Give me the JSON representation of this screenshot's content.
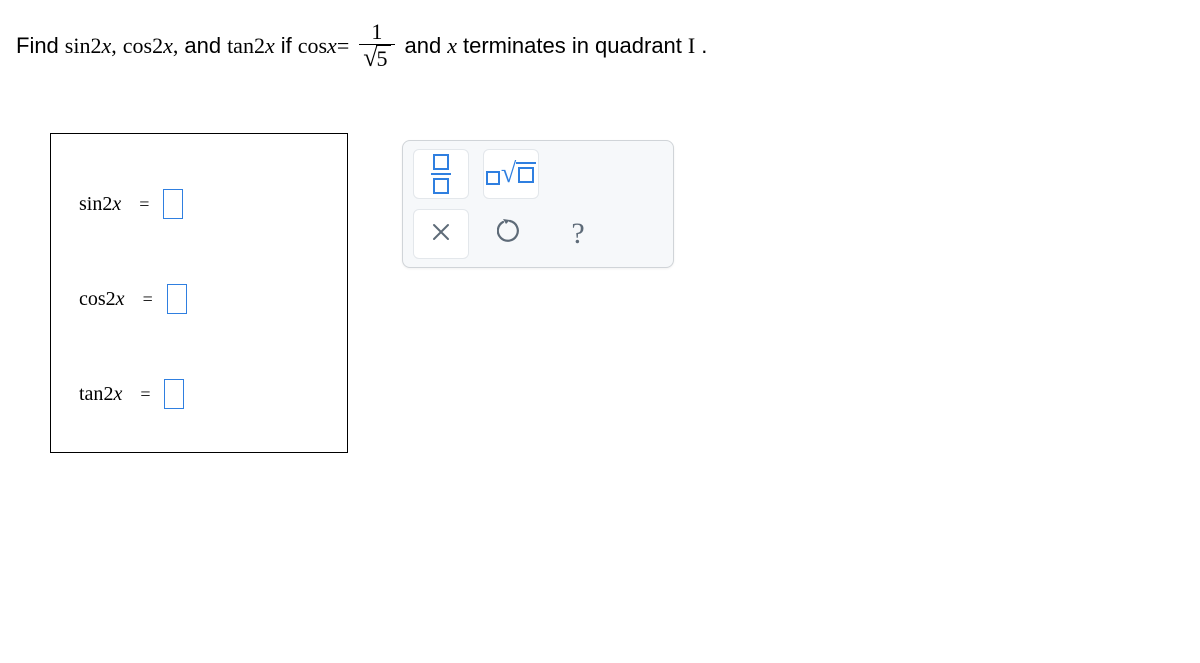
{
  "problem": {
    "prefix": "Find",
    "t1": "sin",
    "t2": "2",
    "var": "x",
    "comma": ",",
    "t3": "cos",
    "and1": "and",
    "t4": "tan",
    "if": "if",
    "cosx": "cos",
    "eq": "=",
    "num": "1",
    "den_rad": "5",
    "and2": "and",
    "term": "terminates in quadrant",
    "quad": "I",
    "period": "."
  },
  "answers": {
    "r1": {
      "fn": "sin",
      "arg": "2",
      "var": "x"
    },
    "r2": {
      "fn": "cos",
      "arg": "2",
      "var": "x"
    },
    "r3": {
      "fn": "tan",
      "arg": "2",
      "var": "x"
    },
    "eq": "="
  },
  "toolbar": {
    "help": "?"
  }
}
